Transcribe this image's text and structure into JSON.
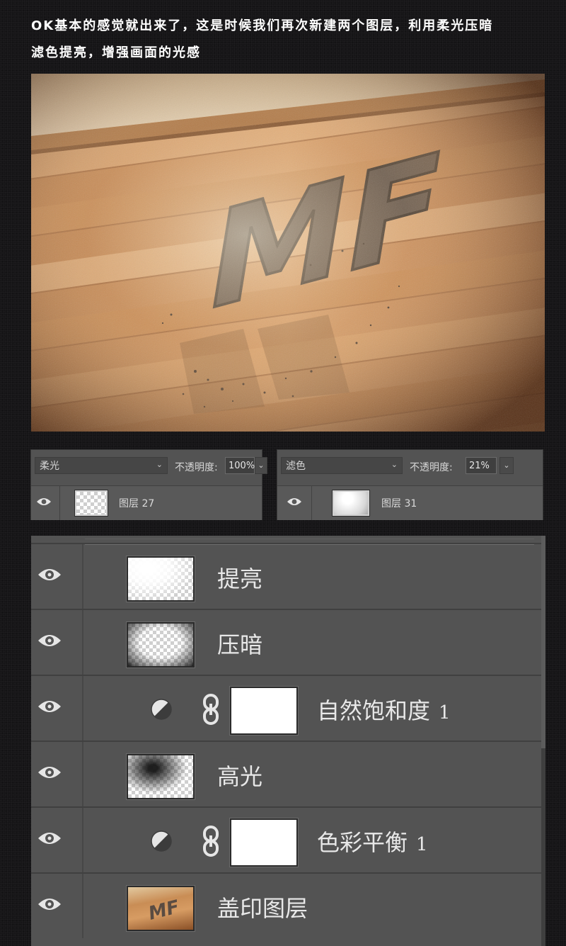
{
  "intro": {
    "line1": "OK基本的感觉就出来了，这是时候我们再次新建两个图层，利用柔光压暗",
    "line2": "滤色提亮，增强画面的光感"
  },
  "scene": {
    "letters": "MF",
    "wood_color": "#c98a54",
    "wall_color": "#d9c7ab"
  },
  "mini_panels": [
    {
      "blend_mode": "柔光",
      "opacity_label": "不透明度:",
      "opacity_value": "100%",
      "layer_name": "图层 27"
    },
    {
      "blend_mode": "滤色",
      "opacity_label": "不透明度:",
      "opacity_value": "21%",
      "layer_name": "图层 31"
    }
  ],
  "layers": [
    {
      "name": "提亮",
      "thumb": "white-glow"
    },
    {
      "name": "压暗",
      "thumb": "dark-vignette"
    },
    {
      "name": "自然饱和度",
      "number": "1",
      "type": "adjustment",
      "icon": "adjustment-circle-icon"
    },
    {
      "name": "高光",
      "thumb": "dark-spot"
    },
    {
      "name": "色彩平衡",
      "number": "1",
      "type": "adjustment",
      "icon": "adjustment-circle-icon"
    },
    {
      "name": "盖印图层",
      "thumb": "photo"
    }
  ]
}
